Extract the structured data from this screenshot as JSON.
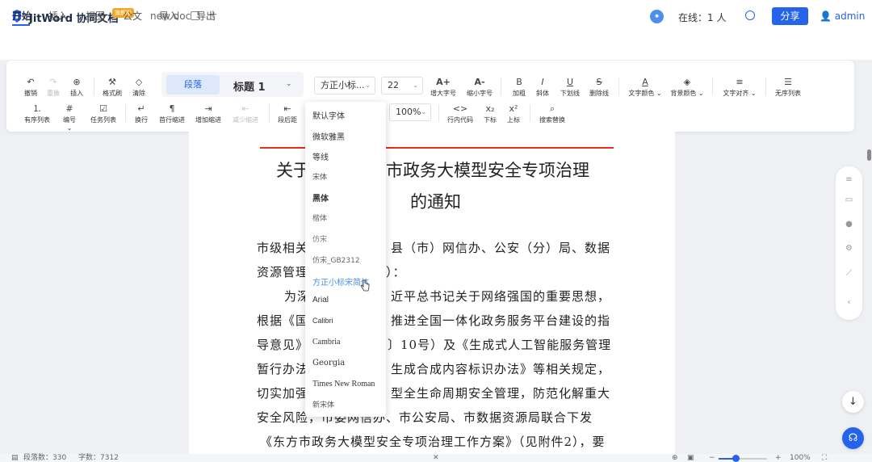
{
  "header": {
    "app_title": "JitWord 协同文档",
    "badge": "旗舰版",
    "doc_name": "new doc",
    "add_tab": "+",
    "online": "在线：1 人",
    "share": "分享",
    "user": "admin"
  },
  "menu": {
    "tabs": [
      "开始",
      "插入",
      "视图",
      "公文",
      "导入",
      "导出"
    ],
    "active": 0
  },
  "toolbar": {
    "row1": [
      "撤销",
      "重做",
      "插入",
      "格式刷",
      "清除",
      "加粗",
      "斜体",
      "下划线",
      "删除线",
      "文字颜色",
      "背景颜色",
      "文字对齐",
      "无序列表"
    ],
    "row1_icons": [
      "undo-icon",
      "redo-icon",
      "plus-circle-icon",
      "format-brush-icon",
      "eraser-icon",
      "bold-icon",
      "italic-icon",
      "underline-icon",
      "strikethrough-icon",
      "text-color-icon",
      "bg-color-icon",
      "align-icon",
      "bullet-list-icon"
    ],
    "style_paragraph": "段落",
    "style_heading": "标题 1",
    "font_select": "方正小标...",
    "size_select": "22",
    "font_up": "增大字号",
    "font_down": "缩小字号",
    "row2": [
      "有序列表",
      "编号",
      "任务列表",
      "换行",
      "首行缩进",
      "增加缩进",
      "减少缩进",
      "段后距",
      "行内代码",
      "下标",
      "上标",
      "搜索替换"
    ],
    "zoom_select": "100%"
  },
  "font_dropdown": {
    "items": [
      "默认字体",
      "微软雅黑",
      "等线",
      "宋体",
      "黑体",
      "楷体",
      "仿宋",
      "仿宋_GB2312",
      "方正小标宋简体",
      "Arial",
      "Calibri",
      "Cambria",
      "Georgia",
      "Times New Roman",
      "新宋体"
    ],
    "selected_index": 8
  },
  "document": {
    "title_line1_left": "关于",
    "title_line1_right": "市政务大模型安全专项治理",
    "title_line2": "的通知",
    "lines": [
      "市级相关",
      "县（市）网信办、公安（分）局、数据",
      "资源管理",
      "）：",
      "为深",
      "近平总书记关于网络强国的重要思想，",
      "根据《国",
      "推进全国一体化政务服务平台建设的指",
      "导意见》",
      "〕10号）及《生成式人工智能服务管理",
      "暂行办法",
      "生成合成内容标识办法》等相关规定，",
      "切实加强",
      "型全生命周期安全管理，防范化解重大",
      "安全风险，",
      "市委网信办、市公安局、市数据资源局联合下发",
      "《东方市政务大模型安全专项治理工作方案》（见附件2），要"
    ]
  },
  "status": {
    "paragraphs": "段落数：330",
    "words": "字数：7312",
    "zoom": "100%",
    "zoom_level": 0.35
  }
}
